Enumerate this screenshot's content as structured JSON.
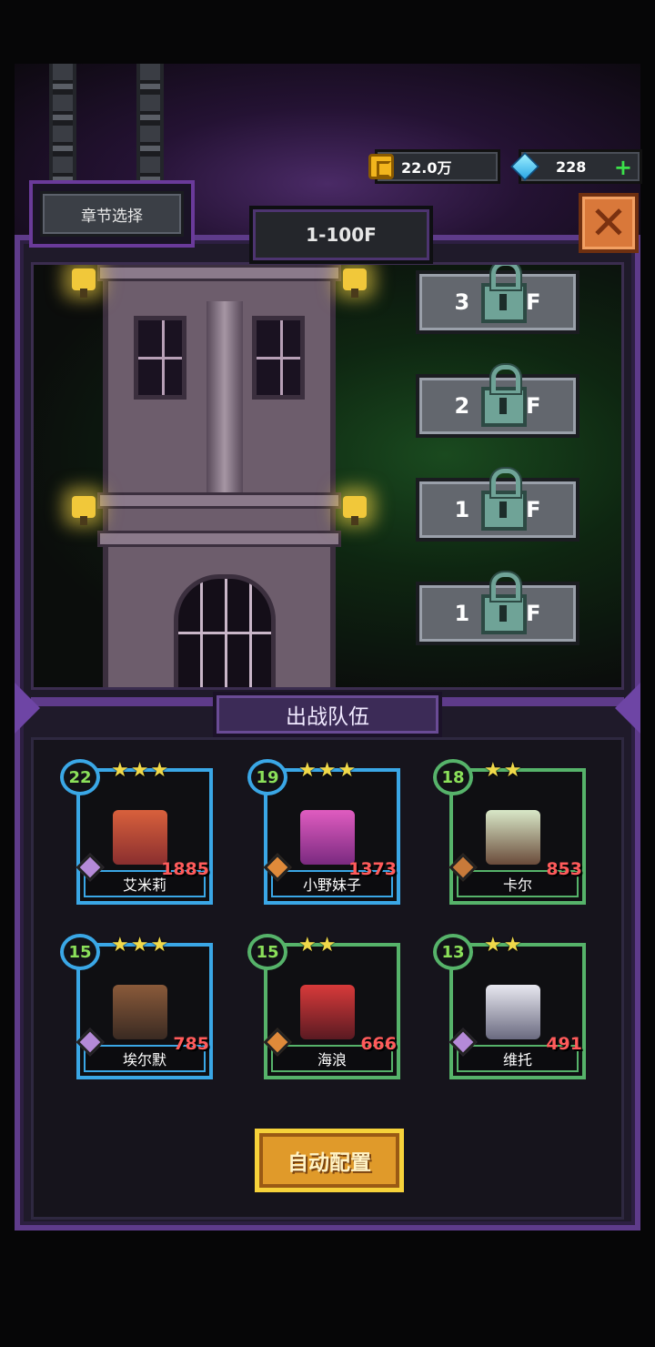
{
  "currency": {
    "coins": "22.0万",
    "gems": "228"
  },
  "header": {
    "chapter_button": "章节选择",
    "floor_range": "1-100F"
  },
  "floors": [
    {
      "label": "3F"
    },
    {
      "label": "2F"
    },
    {
      "label": "1F"
    },
    {
      "label": "1F"
    }
  ],
  "team": {
    "title": "出战队伍",
    "heroes": [
      {
        "name": "艾米莉",
        "level": "22",
        "stars": "★★★",
        "power": "1885"
      },
      {
        "name": "小野妹子",
        "level": "19",
        "stars": "★★★",
        "power": "1373"
      },
      {
        "name": "卡尔",
        "level": "18",
        "stars": "★★",
        "power": "853"
      },
      {
        "name": "埃尔默",
        "level": "15",
        "stars": "★★★",
        "power": "785"
      },
      {
        "name": "海浪",
        "level": "15",
        "stars": "★★",
        "power": "666"
      },
      {
        "name": "维托",
        "level": "13",
        "stars": "★★",
        "power": "491"
      }
    ]
  },
  "auto_button": "自动配置",
  "colors": {
    "frame": "#5e3b8a",
    "blue_rarity": "#3aa7e6",
    "green_rarity": "#56b36a",
    "power": "#ff5b5b",
    "level": "#8be05a"
  }
}
